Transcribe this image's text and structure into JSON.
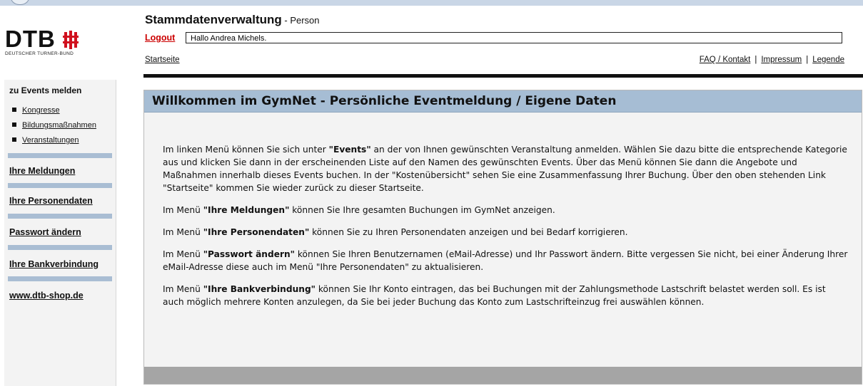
{
  "logo": {
    "text": "DTB",
    "subtitle": "DEUTSCHER TURNER-BUND"
  },
  "header": {
    "title": "Stammdatenverwaltung",
    "title_sub": " - Person",
    "logout_label": "Logout",
    "greeting": "Hallo Andrea Michels.",
    "start_link": "Startseite",
    "links": [
      "FAQ / Kontakt",
      "Impressum",
      "Legende"
    ],
    "separator": "|"
  },
  "sidebar": {
    "heading": "zu Events melden",
    "events": [
      "Kongresse",
      "Bildungsmaßnahmen",
      "Veranstaltungen"
    ],
    "menu": [
      "Ihre Meldungen",
      "Ihre Personendaten",
      "Passwort ändern",
      "Ihre Bankverbindung",
      "www.dtb-shop.de"
    ]
  },
  "main": {
    "title": "Willkommen im GymNet - Persönliche Eventmeldung / Eigene Daten",
    "paragraphs": [
      {
        "pre": "Im linken Menü können Sie sich unter ",
        "bold": "\"Events\"",
        "post": " an der von Ihnen gewünschten Veranstaltung anmelden. Wählen Sie dazu bitte die entsprechende Kategorie aus und klicken Sie dann in der erscheinenden Liste auf den Namen des gewünschten Events. Über das Menü können Sie dann die Angebote und Maßnahmen innerhalb dieses Events buchen. In der \"Kostenübersicht\" sehen Sie eine Zusammenfassung Ihrer Buchung. Über den oben stehenden Link \"Startseite\" kommen Sie wieder zurück zu dieser Startseite."
      },
      {
        "pre": "Im Menü ",
        "bold": "\"Ihre Meldungen\"",
        "post": " können Sie Ihre gesamten Buchungen im GymNet anzeigen."
      },
      {
        "pre": "Im Menü ",
        "bold": "\"Ihre Personendaten\"",
        "post": " können Sie zu Ihren Personendaten anzeigen und bei Bedarf korrigieren."
      },
      {
        "pre": "Im Menü ",
        "bold": "\"Passwort ändern\"",
        "post": " können Sie Ihren Benutzernamen (eMail-Adresse) und Ihr Passwort ändern. Bitte vergessen Sie nicht, bei einer Änderung Ihrer eMail-Adresse diese auch im Menü \"Ihre Personendaten\" zu aktualisieren."
      },
      {
        "pre": "Im Menü ",
        "bold": "\"Ihre Bankverbindung\"",
        "post": " können Sie Ihr Konto eintragen, das bei Buchungen mit der Zahlungsmethode Lastschrift belastet werden soll. Es ist auch möglich mehrere Konten anzulegen, da Sie bei jeder Buchung das Konto zum Lastschrifteinzug frei auswählen können."
      }
    ]
  },
  "colors": {
    "accent": "#a6bdd4",
    "separator": "#a9bdd3",
    "logout": "#cc0000",
    "footer": "#a5a5a5"
  }
}
